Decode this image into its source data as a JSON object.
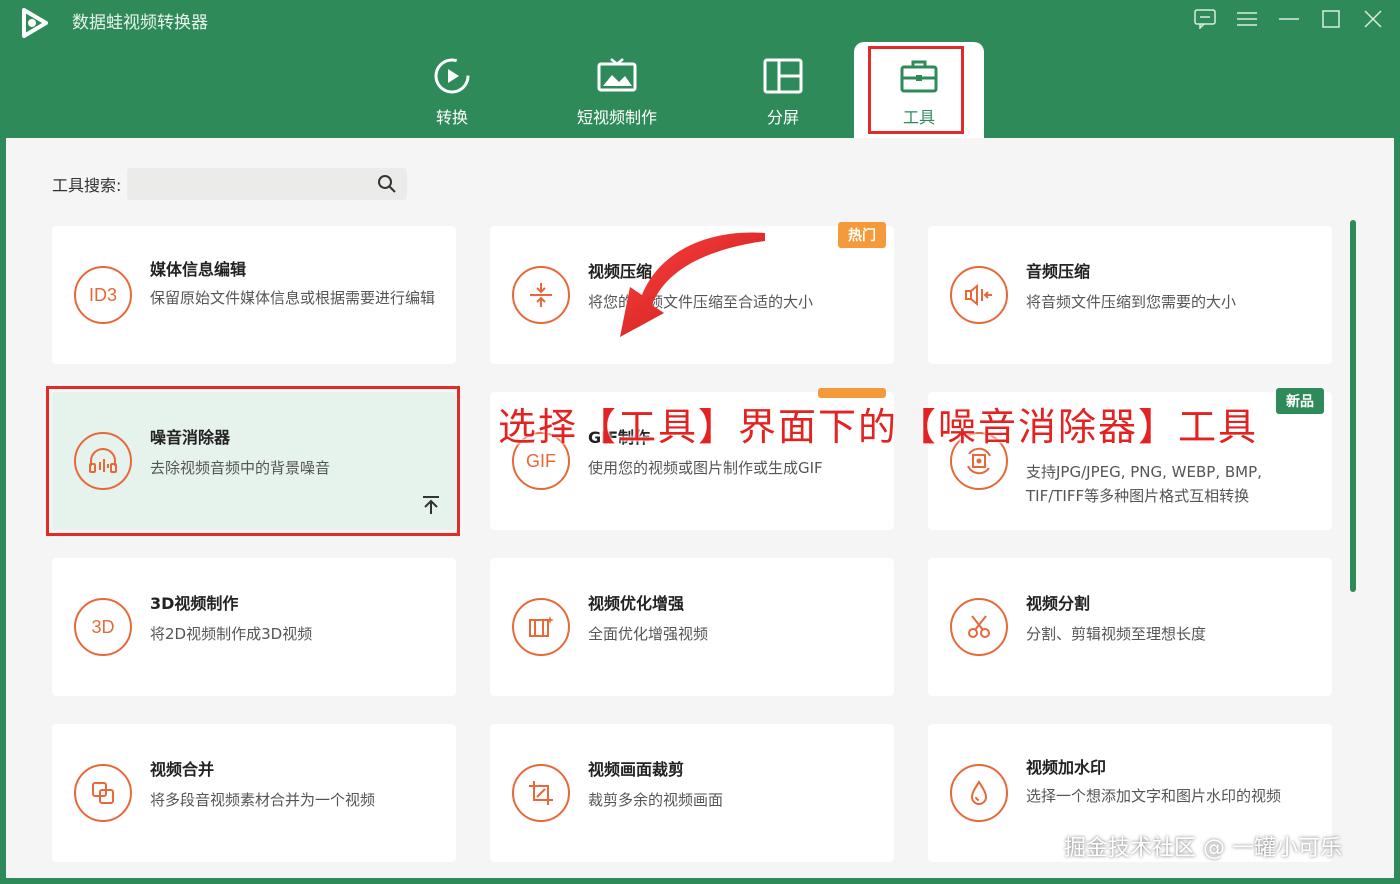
{
  "app": {
    "title": "数据蛙视频转换器"
  },
  "tabs": [
    {
      "label": "转换"
    },
    {
      "label": "短视频制作"
    },
    {
      "label": "分屏"
    },
    {
      "label": "工具"
    }
  ],
  "search": {
    "label": "工具搜索:",
    "placeholder": ""
  },
  "cards": [
    {
      "title": "媒体信息编辑",
      "desc": "保留原始文件媒体信息或根据需要进行编辑",
      "icon": "ID3"
    },
    {
      "title": "视频压缩",
      "desc": "将您的视频文件压缩至合适的大小",
      "badge": "热门"
    },
    {
      "title": "音频压缩",
      "desc": "将音频文件压缩到您需要的大小"
    },
    {
      "title": "噪音消除器",
      "desc": "去除视频音频中的背景噪音"
    },
    {
      "title": "GIF制作",
      "desc": "使用您的视频或图片制作或生成GIF",
      "icon": "GIF"
    },
    {
      "title": "",
      "desc": "支持JPG/JPEG, PNG, WEBP, BMP, TIF/TIFF等多种图片格式互相转换",
      "badge": "新品"
    },
    {
      "title": "3D视频制作",
      "desc": "将2D视频制作成3D视频",
      "icon": "3D"
    },
    {
      "title": "视频优化增强",
      "desc": "全面优化增强视频"
    },
    {
      "title": "视频分割",
      "desc": "分割、剪辑视频至理想长度"
    },
    {
      "title": "视频合并",
      "desc": "将多段音视频素材合并为一个视频"
    },
    {
      "title": "视频画面裁剪",
      "desc": "裁剪多余的视频画面"
    },
    {
      "title": "视频加水印",
      "desc": "选择一个想添加文字和图片水印的视频"
    }
  ],
  "annotation": "选择【工具】界面下的【噪音消除器】工具",
  "watermark": "掘金技术社区 @ 一罐小可乐",
  "colors": {
    "brand": "#2f8a5a",
    "accent": "#e8683a",
    "highlight": "#e02b2b"
  }
}
